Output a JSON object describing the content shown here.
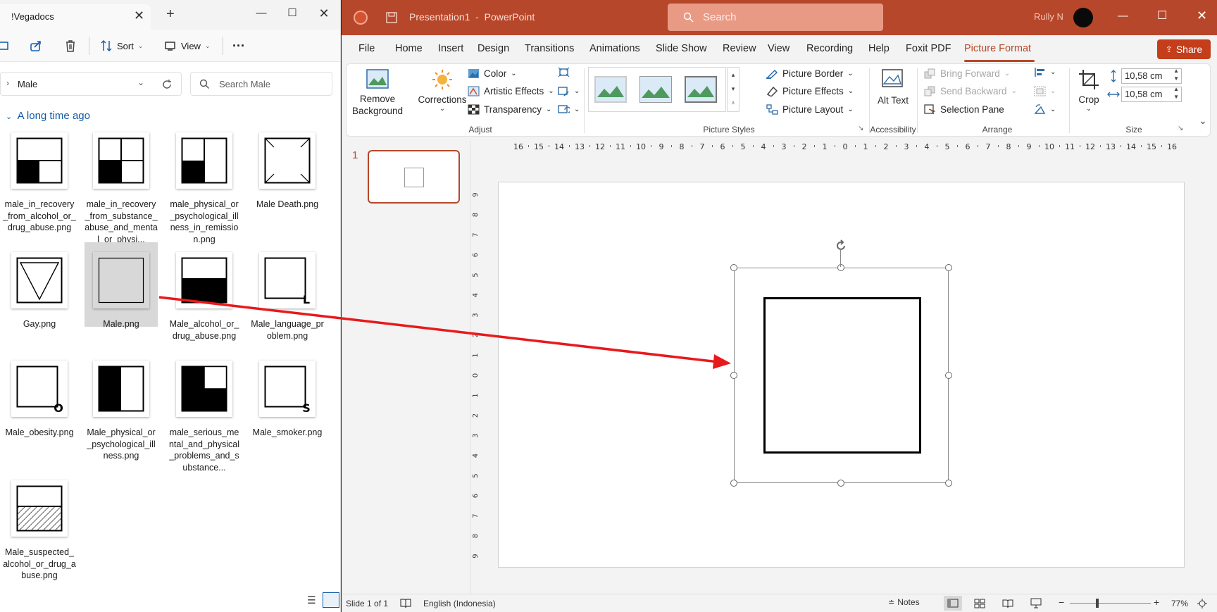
{
  "explorer": {
    "tab_title": "!Vegadocs",
    "toolbar": {
      "sort_label": "Sort",
      "view_label": "View",
      "more_label": "···"
    },
    "address": "Male",
    "search_placeholder": "Search Male",
    "group_label": "A long time ago",
    "files": [
      {
        "name": "male_in_recovery_from_alcohol_or_drug_abuse.png",
        "display": "male_in_recovery_from_alcohol_or_drug_abuse.png",
        "icon": "square-bottom-left-filled"
      },
      {
        "name": "male_in_recovery_from_substance_abuse_and_mental_or_physical",
        "display": "male_in_recovery_from_substance_abuse_and_mental_or_physi...",
        "icon": "square-quadrants-bottom-left-filled"
      },
      {
        "name": "male_physical_or_psychological_illness_in_remission.png",
        "display": "male_physical_or_psychological_illness_in_remission.png",
        "icon": "square-quadrants-one-filled"
      },
      {
        "name": "Male Death.png",
        "display": "Male Death.png",
        "icon": "square-x"
      },
      {
        "name": "Gay.png",
        "display": "Gay.png",
        "icon": "triangle-down"
      },
      {
        "name": "Male.png",
        "display": "Male.png",
        "icon": "square-empty",
        "selected": true
      },
      {
        "name": "Male_alcohol_or_drug_abuse.png",
        "display": "Male_alcohol_or_drug_abuse.png",
        "icon": "square-bottom-half-filled"
      },
      {
        "name": "Male_language_problem.png",
        "display": "Male_language_problem.png",
        "icon": "square-letter-L"
      },
      {
        "name": "Male_obesity.png",
        "display": "Male_obesity.png",
        "icon": "square-letter-O"
      },
      {
        "name": "Male_physical_or_psychological_illness.png",
        "display": "Male_physical_or_psychological_illness.png",
        "icon": "square-left-half-filled"
      },
      {
        "name": "male_serious_mental_and_physical_problems_and_substance",
        "display": "male_serious_mental_and_physical_problems_and_substance...",
        "icon": "square-three-quarters-filled"
      },
      {
        "name": "Male_smoker.png",
        "display": "Male_smoker.png",
        "icon": "square-letter-S"
      },
      {
        "name": "Male_suspected_alcohol_or_drug_abuse.png",
        "display": "Male_suspected_alcohol_or_drug_abuse.png",
        "icon": "square-bottom-hatched"
      }
    ]
  },
  "ppt": {
    "title": "Presentation1  -  PowerPoint",
    "search_placeholder": "Search",
    "user_name": "Rully N",
    "share_label": "Share",
    "tabs": [
      "File",
      "Home",
      "Insert",
      "Design",
      "Transitions",
      "Animations",
      "Slide Show",
      "Review",
      "View",
      "Recording",
      "Help",
      "Foxit PDF",
      "Picture Format"
    ],
    "active_tab": "Picture Format",
    "ribbon": {
      "remove_bg": "Remove Background",
      "corrections": "Corrections",
      "color": "Color",
      "artistic": "Artistic Effects",
      "transparency": "Transparency",
      "group_adjust": "Adjust",
      "group_styles": "Picture Styles",
      "picture_border": "Picture Border",
      "picture_effects": "Picture Effects",
      "picture_layout": "Picture Layout",
      "alt_text": "Alt Text",
      "group_accessibility": "Accessibility",
      "bring_forward": "Bring Forward",
      "send_backward": "Send Backward",
      "selection_pane": "Selection Pane",
      "group_arrange": "Arrange",
      "crop": "Crop",
      "height": "10,58 cm",
      "width": "10,58 cm",
      "group_size": "Size"
    },
    "slide_number": "1",
    "status": {
      "slide_info": "Slide 1 of 1",
      "language": "English (Indonesia)",
      "notes": "Notes",
      "zoom": "77%"
    }
  },
  "colors": {
    "ppt_accent": "#b7472a",
    "annotation_arrow": "#e8191b",
    "selection_blue": "#0f5aa8"
  }
}
